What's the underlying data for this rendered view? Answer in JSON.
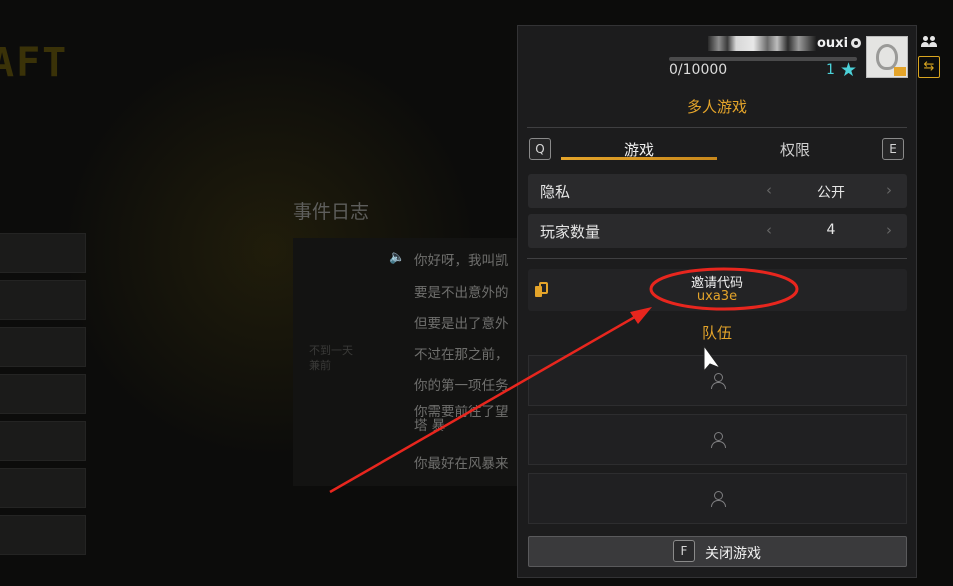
{
  "background": {
    "logo_fragment": "AFT",
    "event_log": {
      "title": "事件日志",
      "side_text": [
        "不到一天",
        "兼前"
      ],
      "lines": [
        "你好呀，我叫凯",
        "要是不出意外的",
        "但要是出了意外",
        "不过在那之前，",
        "你的第一项任务",
        "你需要前往了望塔 暴",
        "你最好在风暴来"
      ]
    }
  },
  "profile": {
    "name_visible": "ouxi",
    "platform_icon": "steam-icon",
    "xp_text": "0/10000",
    "xp_progress": 0.0,
    "level": "1",
    "level_icon": "star-icon"
  },
  "multiplayer": {
    "title": "多人游戏",
    "tabs": {
      "left_key": "Q",
      "right_key": "E",
      "items": [
        "游戏",
        "权限"
      ],
      "active": 0
    },
    "settings": [
      {
        "label": "隐私",
        "value": "公开"
      },
      {
        "label": "玩家数量",
        "value": "4"
      }
    ],
    "invite": {
      "label": "邀请代码",
      "code": "uxa3e"
    },
    "team": {
      "title": "队伍",
      "slot_count": 3
    },
    "close": {
      "key": "F",
      "label": "关闭游戏"
    }
  },
  "annotation": {
    "color": "#e8261e"
  },
  "colors": {
    "accent": "#e4a42a",
    "level": "#4bd1d8",
    "panel": "#1c1c1d"
  }
}
